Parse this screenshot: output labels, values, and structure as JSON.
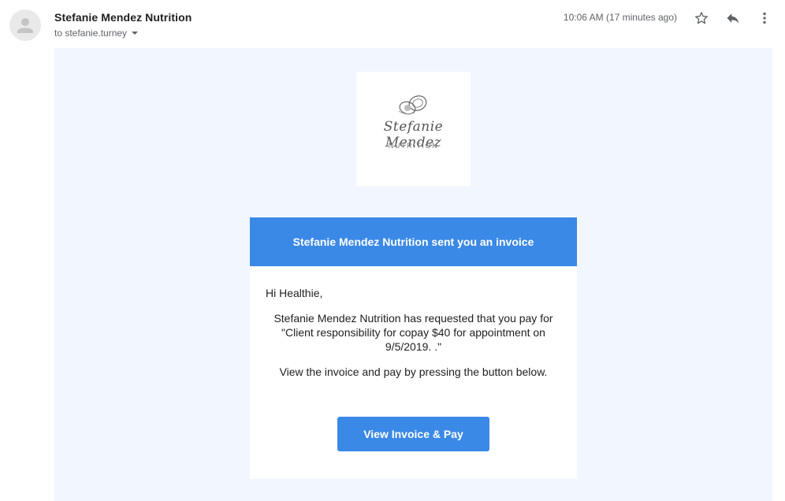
{
  "header": {
    "sender_name": "Stefanie Mendez Nutrition",
    "recipient": "to stefanie.turney",
    "timestamp": "10:06 AM (17 minutes ago)",
    "icons": [
      "avatar-icon",
      "star-icon",
      "reply-icon",
      "more-vert-icon"
    ]
  },
  "email": {
    "logo": {
      "script_text": "Stefanie Mendez",
      "sub_text": "NUTRITION"
    },
    "card_title": "Stefanie Mendez Nutrition sent you an invoice",
    "greeting": "Hi Healthie,",
    "request_text": "Stefanie Mendez Nutrition has requested that you pay for \"Client responsibility for copay $40 for appointment on 9/5/2019. .\"",
    "instruction": "View the invoice and pay by pressing the button below.",
    "button_label": "View Invoice & Pay"
  },
  "colors": {
    "accent": "#3b89e6",
    "mail_background": "#f1f6ff"
  }
}
